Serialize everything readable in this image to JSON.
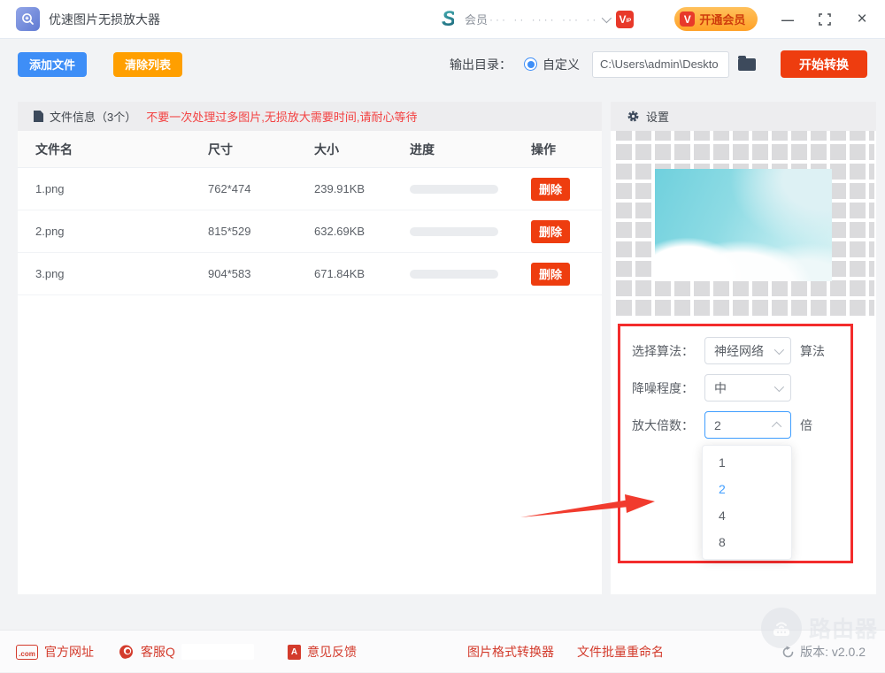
{
  "window": {
    "title": "优速图片无损放大器",
    "member_label": "会员",
    "member_masked": "··· ·· ···· ··· ··",
    "vip_badge": "V",
    "vip_badge_small": "IP",
    "upgrade_label": "开通会员"
  },
  "toolbar": {
    "add_files": "添加文件",
    "clear_list": "清除列表",
    "output_dir_label": "输出目录：",
    "radio_label": "自定义",
    "path_value": "C:\\Users\\admin\\Deskto",
    "start_button": "开始转换"
  },
  "file_panel": {
    "header": "文件信息（3个）",
    "warning": "不要一次处理过多图片,无损放大需要时间,请耐心等待",
    "columns": [
      "文件名",
      "尺寸",
      "大小",
      "进度",
      "操作"
    ],
    "rows": [
      {
        "name": "1.png",
        "dims": "762*474",
        "size": "239.91KB",
        "action": "删除"
      },
      {
        "name": "2.png",
        "dims": "815*529",
        "size": "632.69KB",
        "action": "删除"
      },
      {
        "name": "3.png",
        "dims": "904*583",
        "size": "671.84KB",
        "action": "删除"
      }
    ]
  },
  "settings_panel": {
    "header": "设置",
    "algorithm_label": "选择算法：",
    "algorithm_value": "神经网络",
    "algorithm_suffix": "算法",
    "denoise_label": "降噪程度：",
    "denoise_value": "中",
    "scale_label": "放大倍数：",
    "scale_value": "2",
    "scale_suffix": "倍",
    "scale_options": [
      "1",
      "2",
      "4",
      "8"
    ],
    "scale_selected": "2"
  },
  "footer": {
    "site": "官方网址",
    "qq": "客服Q",
    "feedback": "意见反馈",
    "tool_convert": "图片格式转换器",
    "tool_rename": "文件批量重命名",
    "version": "版本: v2.0.2",
    "watermark": "路由器"
  },
  "colors": {
    "accent_blue": "#3e8ef7",
    "accent_orange": "#ff9f00",
    "accent_red": "#ee3d0f",
    "highlight_red": "#f32c2c",
    "select_blue": "#409eff",
    "warning_red": "#f34141"
  }
}
